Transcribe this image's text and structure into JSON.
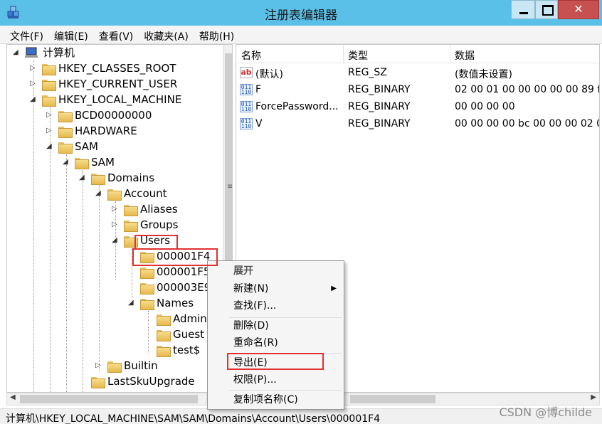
{
  "window": {
    "title": "注册表编辑器"
  },
  "menu": [
    "文件(F)",
    "编辑(E)",
    "查看(V)",
    "收藏夹(A)",
    "帮助(H)"
  ],
  "tree": {
    "root": "计算机",
    "nodes": [
      {
        "label": "HKEY_CLASSES_ROOT"
      },
      {
        "label": "HKEY_CURRENT_USER"
      },
      {
        "label": "HKEY_LOCAL_MACHINE"
      },
      {
        "label": "BCD00000000"
      },
      {
        "label": "HARDWARE"
      },
      {
        "label": "SAM"
      },
      {
        "label": "SAM"
      },
      {
        "label": "Domains"
      },
      {
        "label": "Account"
      },
      {
        "label": "Aliases"
      },
      {
        "label": "Groups"
      },
      {
        "label": "Users"
      },
      {
        "label": "000001F4"
      },
      {
        "label": "000001F5"
      },
      {
        "label": "000003E9"
      },
      {
        "label": "Names"
      },
      {
        "label": "Admin"
      },
      {
        "label": "Guest"
      },
      {
        "label": "test$"
      },
      {
        "label": "Builtin"
      },
      {
        "label": "LastSkuUpgrade"
      }
    ]
  },
  "list": {
    "columns": [
      "名称",
      "类型",
      "数据"
    ],
    "rows": [
      {
        "name": "(默认)",
        "type": "REG_SZ",
        "data": "(数值未设置)",
        "icon": "string-value-icon"
      },
      {
        "name": "F",
        "type": "REG_BINARY",
        "data": "02 00 01 00 00 00 00 00 89 f",
        "icon": "binary-value-icon"
      },
      {
        "name": "ForcePassword...",
        "type": "REG_BINARY",
        "data": "00 00 00 00",
        "icon": "binary-value-icon"
      },
      {
        "name": "V",
        "type": "REG_BINARY",
        "data": "00 00 00 00 bc 00 00 00 02 0",
        "icon": "binary-value-icon"
      }
    ]
  },
  "context_menu": {
    "expand": "展开",
    "new": "新建(N)",
    "find": "查找(F)...",
    "delete": "删除(D)",
    "rename": "重命名(R)",
    "export": "导出(E)",
    "permissions": "权限(P)...",
    "copy_key_name": "复制项名称(C)"
  },
  "statusbar": {
    "path": "计算机\\HKEY_LOCAL_MACHINE\\SAM\\SAM\\Domains\\Account\\Users\\000001F4"
  },
  "watermark": "CSDN @博childe",
  "colors": {
    "titlebar": "#5bc0e8",
    "highlight": "#e03030",
    "close": "#c75050"
  }
}
